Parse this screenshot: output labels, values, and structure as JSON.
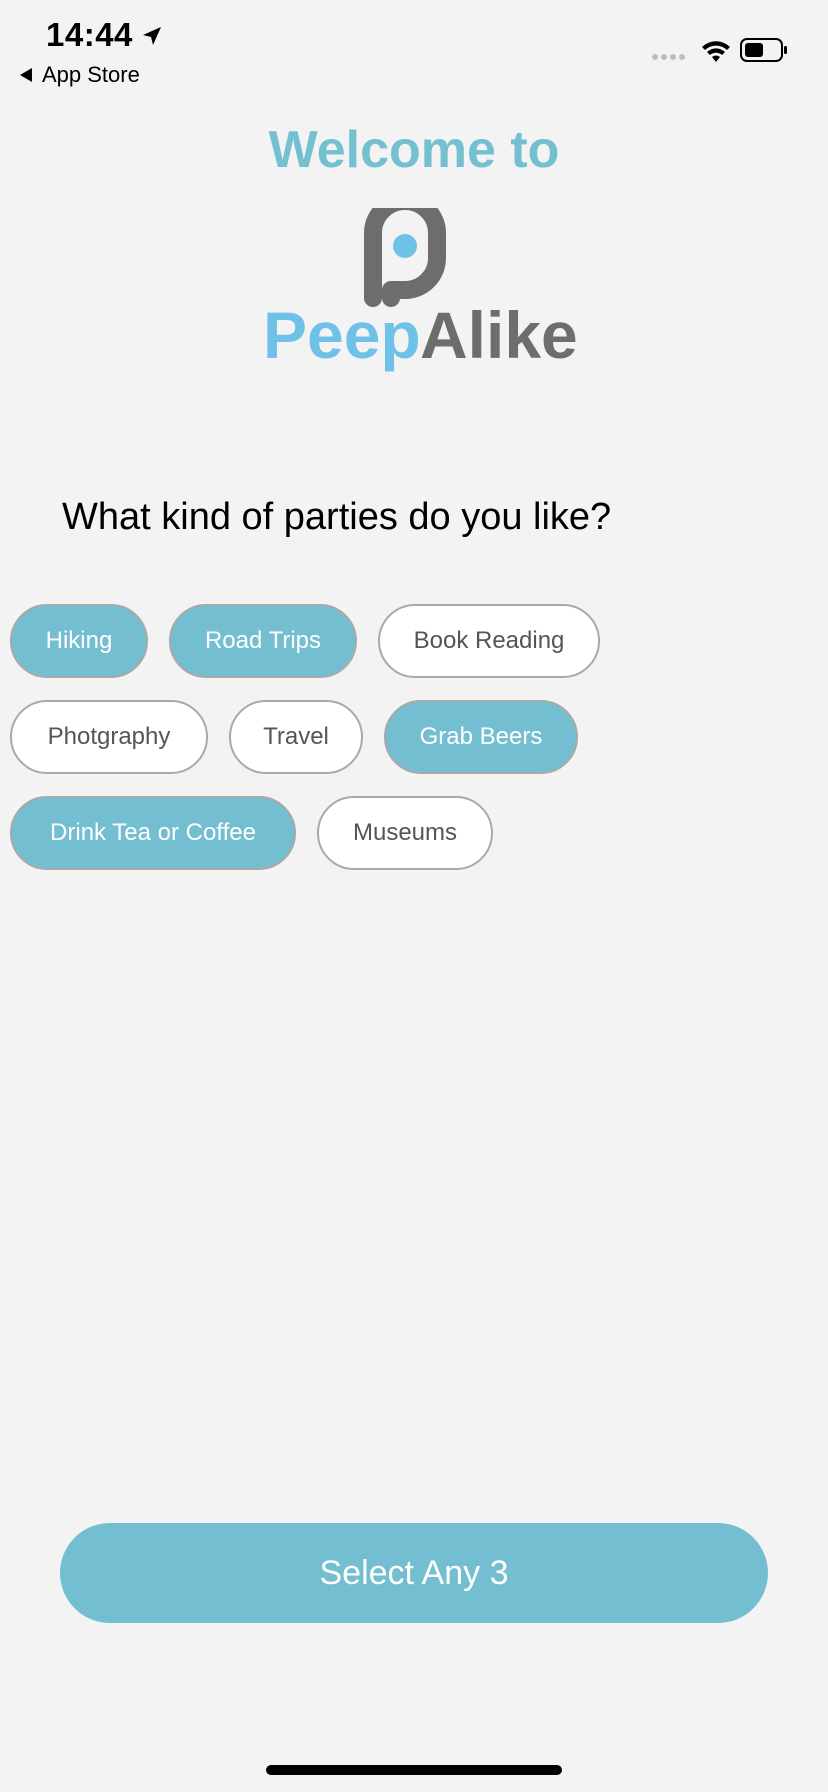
{
  "status_bar": {
    "time": "14:44",
    "back_app": "App Store",
    "icons": [
      "location-arrow-icon",
      "signal-icon",
      "wifi-icon",
      "battery-icon"
    ]
  },
  "header": {
    "welcome": "Welcome to",
    "logo_text": "PeepAlike"
  },
  "question": "What kind of parties do you like?",
  "chips": [
    {
      "label": "Hiking",
      "selected": true
    },
    {
      "label": "Road Trips",
      "selected": true
    },
    {
      "label": "Book Reading",
      "selected": false
    },
    {
      "label": "Photgraphy",
      "selected": false
    },
    {
      "label": "Travel",
      "selected": false
    },
    {
      "label": "Grab Beers",
      "selected": true
    },
    {
      "label": "Drink Tea or Coffee",
      "selected": true
    },
    {
      "label": "Museums",
      "selected": false
    }
  ],
  "cta": {
    "label": "Select Any 3"
  },
  "colors": {
    "accent": "#73bfd1",
    "background": "#f3f3f4",
    "logo_gray": "#6d6d6d",
    "logo_blue": "#6ec2e8"
  }
}
